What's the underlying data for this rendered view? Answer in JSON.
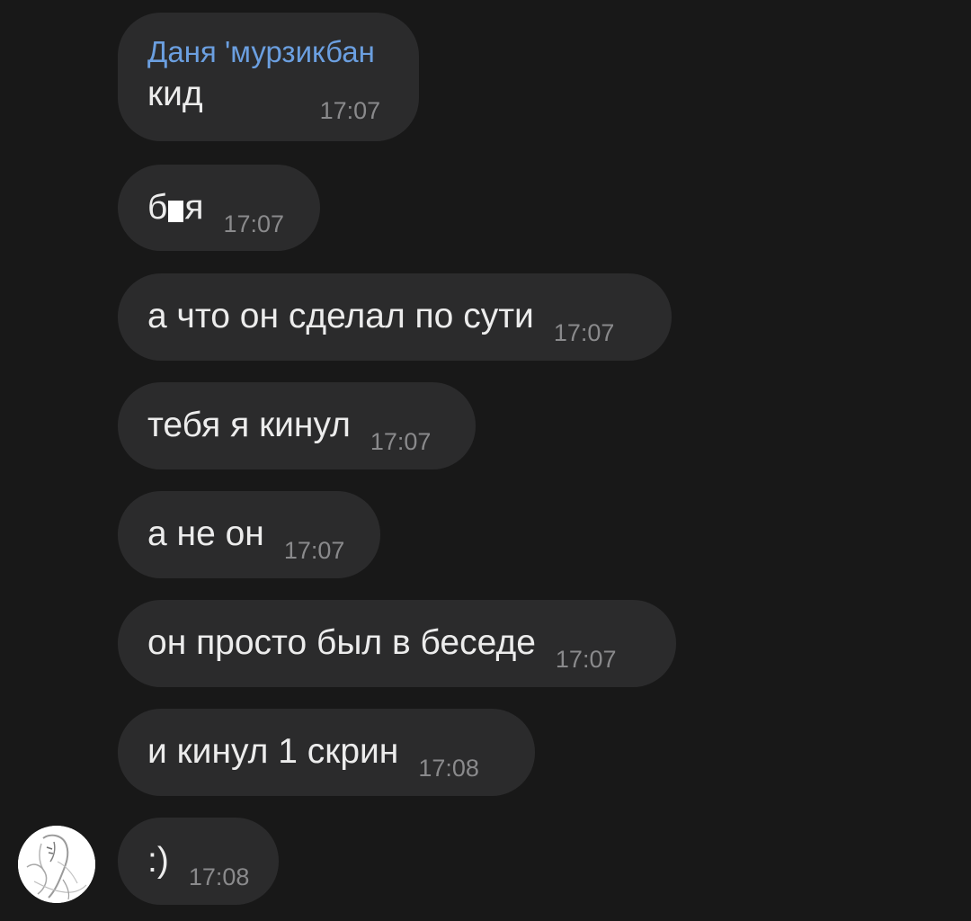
{
  "messages": [
    {
      "sender": "Даня 'мурзикбан",
      "text": "кид",
      "time": "17:07"
    },
    {
      "text_before": "б",
      "text_after": "я",
      "time": "17:07"
    },
    {
      "text": "а что он сделал по сути",
      "time": "17:07"
    },
    {
      "text": "тебя я кинул",
      "time": "17:07"
    },
    {
      "text": "а не он",
      "time": "17:07"
    },
    {
      "text": "он просто был в беседе",
      "time": "17:07"
    },
    {
      "text": "и кинул 1 скрин",
      "time": "17:08"
    },
    {
      "text": ":)",
      "time": "17:08"
    }
  ],
  "colors": {
    "background": "#181818",
    "bubble": "#2b2b2c",
    "text": "#ececec",
    "time": "#8a8a8c",
    "sender": "#6b9fe0",
    "censor": "#ffffff"
  },
  "icons": {
    "avatar": "user-avatar-anime-sketch"
  }
}
